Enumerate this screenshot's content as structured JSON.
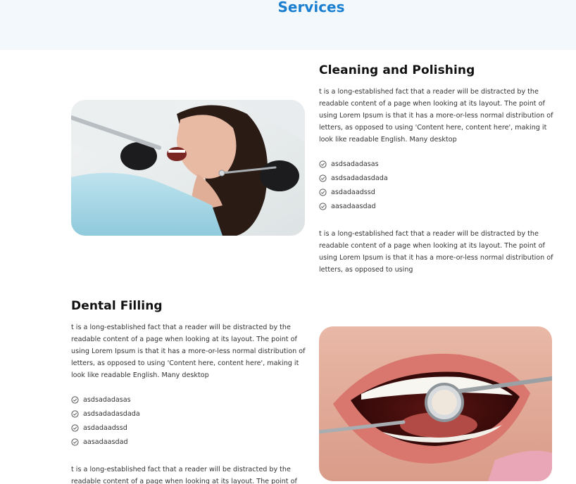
{
  "page": {
    "heading": "Services"
  },
  "services": [
    {
      "title": "Cleaning and Polishing",
      "description": "t is a long-established fact that a reader will be distracted by the readable content of a page when looking at its layout. The point of using Lorem Ipsum is that it has a more-or-less normal distribution of letters, as opposed to using 'Content here, content here', making it look like readable English. Many desktop",
      "features": [
        "asdsadadasas",
        "asdsadadasdada",
        "asdadaadssd",
        "aasadaasdad"
      ],
      "footer_text": "t is a long-established fact that a reader will be distracted by the readable content of a page when looking at its layout. The point of using Lorem Ipsum is that it has a more-or-less normal distribution of letters, as opposed to using"
    },
    {
      "title": "Dental Filling",
      "description": "t is a long-established fact that a reader will be distracted by the readable content of a page when looking at its layout. The point of using Lorem Ipsum is that it has a more-or-less normal distribution of letters, as opposed to using 'Content here, content here', making it look like readable English. Many desktop",
      "features": [
        "asdsadadasas",
        "asdsadadasdada",
        "asdadaadssd",
        "aasadaasdad"
      ],
      "footer_text": "t is a long-established fact that a reader will be distracted by the readable content of a page when looking at its layout. The point of"
    }
  ],
  "colors": {
    "accent": "#1a7fd0",
    "hero_bg": "#f3f8fc",
    "check": "#555555"
  },
  "icons": {
    "feature": "check-circle-icon"
  }
}
